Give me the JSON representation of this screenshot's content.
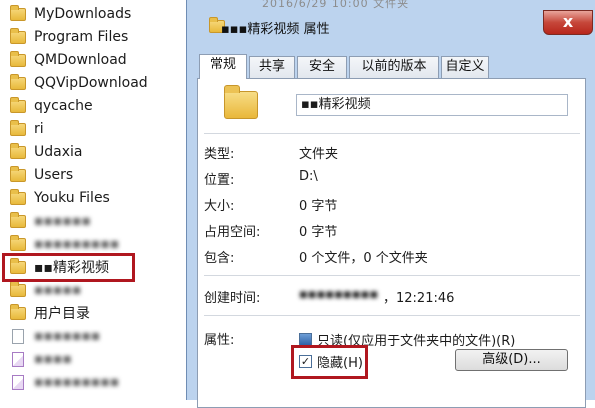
{
  "explorer": {
    "items": [
      {
        "label": "MyDownloads",
        "icon": "folder-icon"
      },
      {
        "label": "Program Files",
        "icon": "folder-icon"
      },
      {
        "label": "QMDownload",
        "icon": "folder-icon"
      },
      {
        "label": "QQVipDownload",
        "icon": "folder-icon"
      },
      {
        "label": "qycache",
        "icon": "folder-icon"
      },
      {
        "label": "ri",
        "icon": "folder-icon"
      },
      {
        "label": "Udaxia",
        "icon": "folder-icon"
      },
      {
        "label": "Users",
        "icon": "folder-icon"
      },
      {
        "label": "Youku Files",
        "icon": "folder-icon"
      },
      {
        "label": "▪▪▪▪▪▪",
        "icon": "folder-icon"
      },
      {
        "label": "▪▪▪▪▪▪▪▪▪",
        "icon": "folder-icon"
      },
      {
        "label": "▪▪精彩视频",
        "icon": "folder-icon"
      },
      {
        "label": "▪▪▪▪▪",
        "icon": "folder-icon"
      },
      {
        "label": "用户目录",
        "icon": "folder-icon"
      },
      {
        "label": "▪▪▪▪▪▪▪",
        "icon": "file-icon"
      },
      {
        "label": "▪▪▪▪",
        "icon": "image-file-icon"
      },
      {
        "label": "▪▪▪▪▪▪▪▪▪",
        "icon": "image-file-icon"
      }
    ]
  },
  "dialog": {
    "date_strip": "2016/6/29 10:00      文件夹",
    "title": "▪▪▪精彩视频 属性",
    "close_label": "x",
    "tabs": [
      "常规",
      "共享",
      "安全",
      "以前的版本",
      "自定义"
    ],
    "name": "▪▪精彩视频",
    "props": {
      "type_label": "类型:",
      "type_value": "文件夹",
      "location_label": "位置:",
      "location_value": "D:\\",
      "size_label": "大小:",
      "size_value": "0 字节",
      "disk_label": "占用空间:",
      "disk_value": "0 字节",
      "contains_label": "包含:",
      "contains_value": "0 个文件，0 个文件夹",
      "created_label": "创建时间:",
      "created_date": "▪▪▪▪▪▪▪▪▪",
      "created_time": "，12:21:46",
      "attr_label": "属性:",
      "readonly_label": "只读(仅应用于文件夹中的文件)(R)",
      "hidden_label": "隐藏(H)",
      "hidden_check": "✓",
      "advanced_label": "高级(D)..."
    }
  },
  "colors": {
    "highlight_frame": "#b0171f",
    "dialog_frame": "#bcd3ee"
  }
}
